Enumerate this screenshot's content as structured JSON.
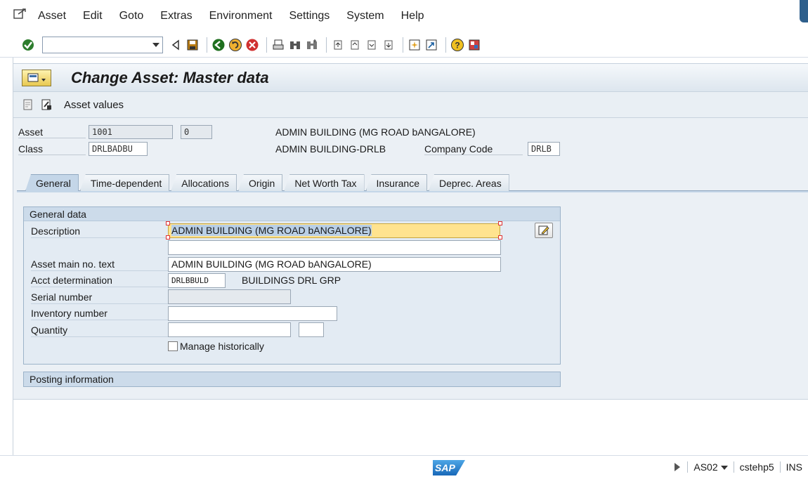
{
  "menu": {
    "items": [
      "Asset",
      "Edit",
      "Goto",
      "Extras",
      "Environment",
      "Settings",
      "System",
      "Help"
    ]
  },
  "toolbar": {
    "command_value": ""
  },
  "title": "Change Asset:  Master data",
  "app_toolbar": {
    "asset_values_label": "Asset values"
  },
  "header": {
    "asset_label": "Asset",
    "asset_number": "1001",
    "sub_number": "0",
    "asset_description": "ADMIN BUILDING (MG ROAD bANGALORE)",
    "class_label": "Class",
    "class_value": "DRLBADBU",
    "class_description": "ADMIN BUILDING-DRLB",
    "company_code_label": "Company Code",
    "company_code_value": "DRLB"
  },
  "tabs": [
    "General",
    "Time-dependent",
    "Allocations",
    "Origin",
    "Net Worth Tax",
    "Insurance",
    "Deprec. Areas"
  ],
  "general_data": {
    "heading": "General data",
    "description_label": "Description",
    "description_value": "ADMIN BUILDING (MG ROAD bANGALORE)",
    "description_line2": "",
    "asset_main_text_label": "Asset main no. text",
    "asset_main_text_value": "ADMIN BUILDING (MG ROAD bANGALORE)",
    "acct_determination_label": "Acct determination",
    "acct_determination_value": "DRLBBULD",
    "acct_determination_text": "BUILDINGS DRL GRP",
    "serial_number_label": "Serial number",
    "serial_number_value": "",
    "inventory_number_label": "Inventory number",
    "inventory_number_value": "",
    "quantity_label": "Quantity",
    "quantity_value": "",
    "quantity_unit": "",
    "manage_historically_label": "Manage historically",
    "manage_historically_checked": false
  },
  "posting_information": {
    "heading": "Posting information"
  },
  "status_bar": {
    "logo_text": "SAP",
    "transaction": "AS02",
    "server": "cstehp5",
    "mode": "INS"
  },
  "colors": {
    "title_bar": "#dde6ee",
    "tab_active": "#c4d6e8",
    "focus_field": "#ffe38f",
    "group_head": "#ccdbea"
  }
}
